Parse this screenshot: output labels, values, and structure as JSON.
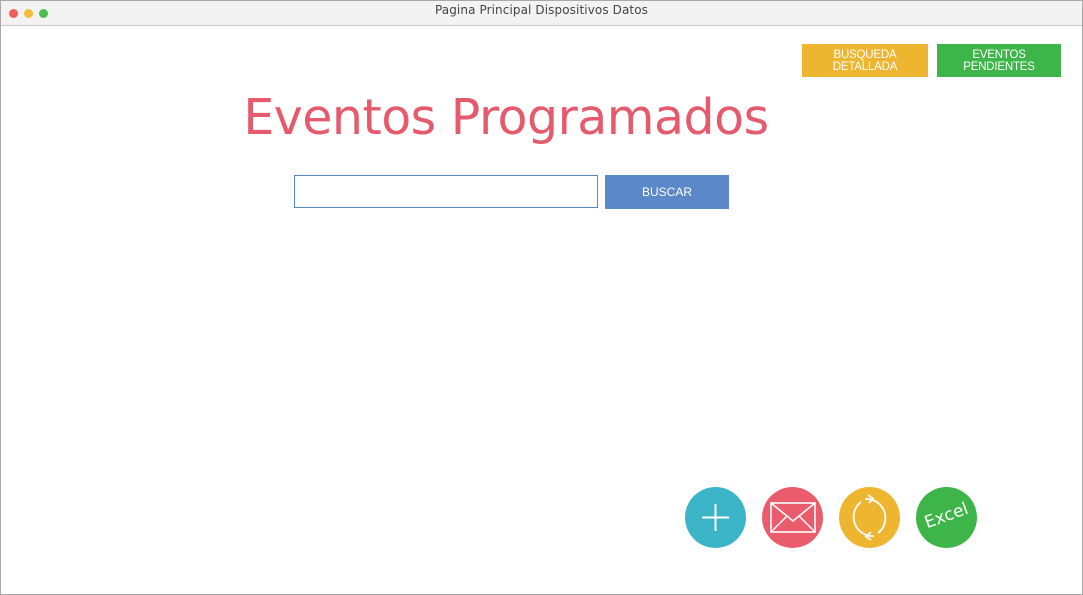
{
  "window": {
    "title": "Pagina Principal Dispositivos Datos"
  },
  "toolbar": {
    "detailed_search_label": "BUSQUEDA DETALLADA",
    "pending_events_label": "EVENTOS PENDIENTES"
  },
  "main": {
    "title": "Eventos Programados",
    "search": {
      "value": "",
      "placeholder": "",
      "button_label": "BUSCAR"
    }
  },
  "actions": {
    "add": {
      "icon": "plus-icon",
      "color": "#3ab4c6"
    },
    "mail": {
      "icon": "envelope-icon",
      "color": "#ea5b6b"
    },
    "sync": {
      "icon": "refresh-icon",
      "color": "#eeb531"
    },
    "excel": {
      "label": "Excel",
      "color": "#3db548"
    }
  },
  "colors": {
    "title": "#e55a6d",
    "search_button": "#5b88c8",
    "detailed_search": "#eeb531",
    "pending_events": "#3db548"
  }
}
